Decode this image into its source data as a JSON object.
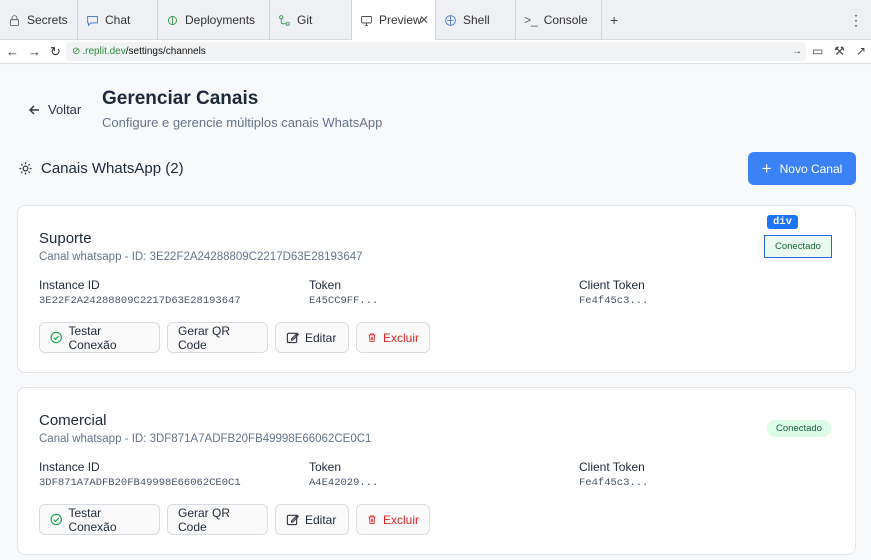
{
  "browser": {
    "tabs": [
      {
        "label": "Secrets",
        "icon": "lock-icon"
      },
      {
        "label": "Chat",
        "icon": "chat-icon"
      },
      {
        "label": "Deployments",
        "icon": "deploy-icon"
      },
      {
        "label": "Git",
        "icon": "git-icon"
      },
      {
        "label": "Preview",
        "icon": "monitor-icon",
        "active": true
      },
      {
        "label": "Shell",
        "icon": "shell-icon"
      },
      {
        "label": "Console",
        "icon": "console-icon"
      }
    ],
    "url_domain": ".replit.dev",
    "url_path": "/settings/channels"
  },
  "page": {
    "back_label": "Voltar",
    "title": "Gerenciar Canais",
    "subtitle": "Configure e gerencie múltiplos canais WhatsApp",
    "section_title": "Canais WhatsApp (2)",
    "new_channel_label": "Novo Canal",
    "inspector_tag": "div"
  },
  "field_labels": {
    "instance": "Instance ID",
    "token": "Token",
    "client_token": "Client Token"
  },
  "actions": {
    "test": "Testar Conexão",
    "qr": "Gerar QR Code",
    "edit": "Editar",
    "delete": "Excluir"
  },
  "channels": [
    {
      "name": "Suporte",
      "description": "Canal whatsapp - ID: 3E22F2A24288809C2217D63E28193647",
      "status": "Conectado",
      "instance_id": "3E22F2A24288809C2217D63E28193647",
      "token": "E45CC9FF...",
      "client_token": "Fe4f45c3..."
    },
    {
      "name": "Comercial",
      "description": "Canal whatsapp - ID: 3DF871A7ADFB20FB49998E66062CE0C1",
      "status": "Conectado",
      "instance_id": "3DF871A7ADFB20FB49998E66062CE0C1",
      "token": "A4E42029...",
      "client_token": "Fe4f45c3..."
    }
  ],
  "colors": {
    "primary": "#3b82f6",
    "success_bg": "#dcfce7",
    "success_text": "#166534",
    "danger": "#dc2626"
  }
}
